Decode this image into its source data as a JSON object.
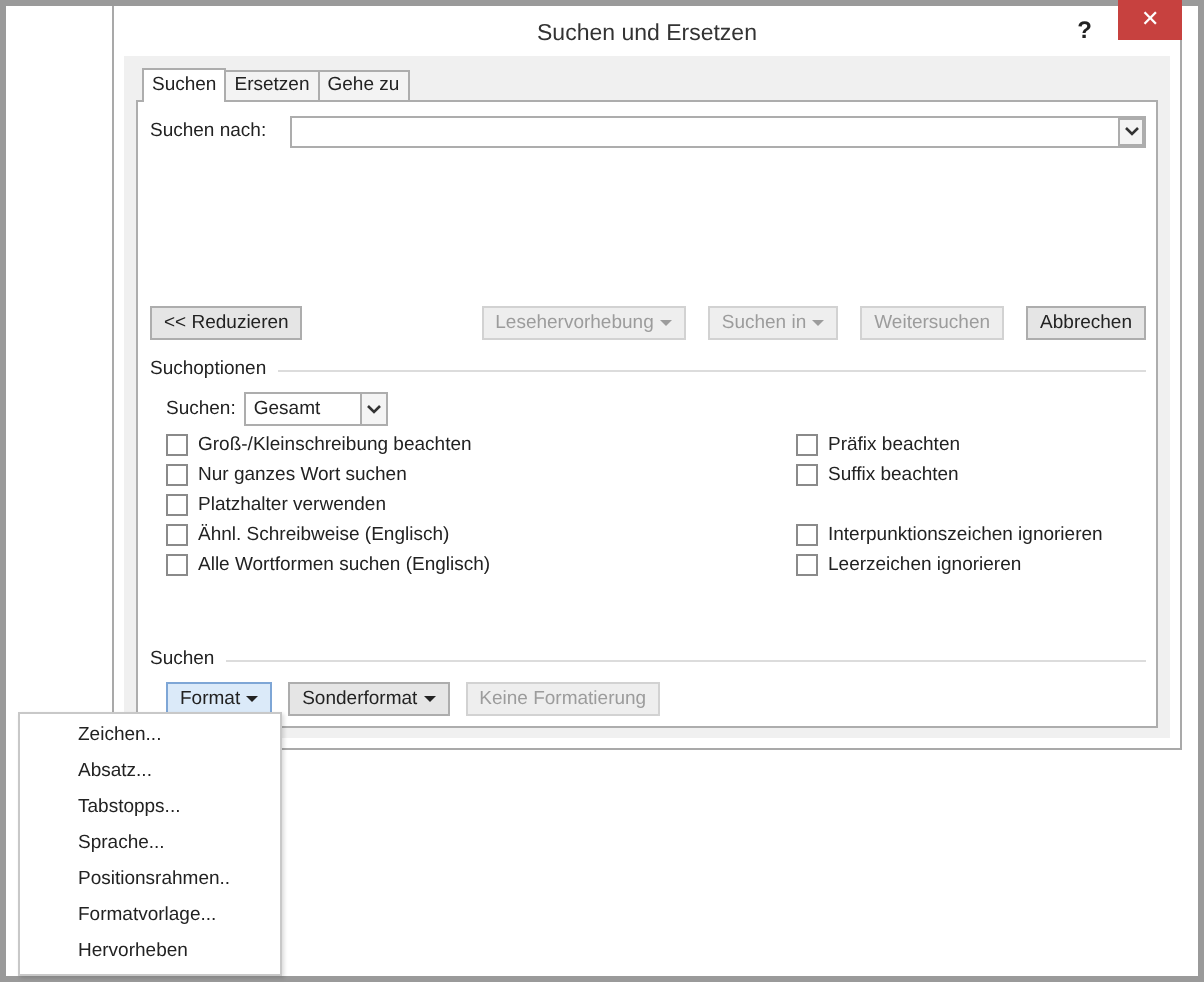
{
  "window": {
    "title": "Suchen und Ersetzen",
    "help": "?",
    "close": "✕"
  },
  "tabs": [
    {
      "label": "Suchen",
      "selected": true
    },
    {
      "label": "Ersetzen",
      "selected": false
    },
    {
      "label": "Gehe zu",
      "selected": false
    }
  ],
  "find": {
    "label": "Suchen nach:"
  },
  "buttons": [
    {
      "label": "<< Reduzieren",
      "disabled": false,
      "dropdown": false
    },
    {
      "label": "Lesehervorhebung",
      "disabled": true,
      "dropdown": true
    },
    {
      "label": "Suchen in",
      "disabled": true,
      "dropdown": true
    },
    {
      "label": "Weitersuchen",
      "disabled": true,
      "dropdown": false
    },
    {
      "label": "Abbrechen",
      "disabled": false,
      "dropdown": false
    }
  ],
  "options": {
    "title": "Suchoptionen",
    "direction_label": "Suchen:",
    "direction_value": "Gesamt",
    "rows": [
      {
        "left": {
          "label": "Groß-/Kleinschreibung beachten",
          "checked": false
        },
        "right": {
          "label": "Präfix beachten",
          "checked": false
        }
      },
      {
        "left": {
          "label": "Nur ganzes Wort suchen",
          "checked": false
        },
        "right": {
          "label": "Suffix beachten",
          "checked": false
        }
      },
      {
        "left": {
          "label": "Platzhalter verwenden",
          "checked": false
        }
      },
      {
        "left": {
          "label": "Ähnl. Schreibweise (Englisch)",
          "checked": false
        },
        "right": {
          "label": "Interpunktionszeichen ignorieren",
          "checked": false
        }
      },
      {
        "left": {
          "label": "Alle Wortformen suchen (Englisch)",
          "checked": false
        },
        "right": {
          "label": "Leerzeichen ignorieren",
          "checked": false
        }
      }
    ]
  },
  "search_section": {
    "title": "Suchen",
    "buttons": [
      {
        "label": "Format",
        "disabled": false,
        "dropdown": true,
        "pressed": true
      },
      {
        "label": "Sonderformat",
        "disabled": false,
        "dropdown": true,
        "pressed": false
      },
      {
        "label": "Keine Formatierung",
        "disabled": true,
        "dropdown": false,
        "pressed": false
      }
    ]
  },
  "menu": {
    "items": [
      "Zeichen...",
      "Absatz...",
      "Tabstopps...",
      "Sprache...",
      "Positionsrahmen..",
      "Formatvorlage...",
      "Hervorheben"
    ]
  }
}
